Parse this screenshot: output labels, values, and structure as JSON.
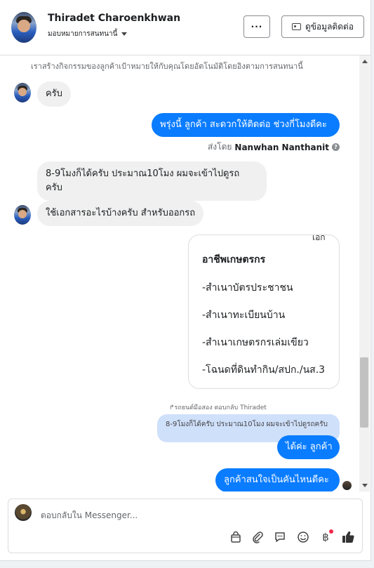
{
  "header": {
    "contact_name": "Thiradet Charoenkhwan",
    "assign_label": "มอบหมายการสนทนานี้",
    "more_label": "···",
    "contact_info_label": "ดูข้อมูลติดต่อ"
  },
  "conversation": {
    "system_note": "เราสร้างกิจกรรมของลูกค้าเป้าหมายให้กับคุณโดยอัตโนมัติโดยอิงตามการสนทนานี้",
    "messages": [
      {
        "text": "ครับ"
      },
      {
        "text": "พรุ่งนี้ ลูกค้า สะดวกให้ติดต่อ ช่วงกี่โมงดีคะ"
      },
      {
        "text": "8-9โมงก็ได้ครับ ประมาณ10โมง ผมจะเข้าไปดูรถ ครับ"
      },
      {
        "text": "ใช้เอกสารอะไรบ้างครับ สำหรับออกรถ"
      },
      {
        "text": "ได้ค่ะ ลูกค้า"
      },
      {
        "text": "ลูกค้าสนใจเป็นคันไหนดีคะ"
      }
    ],
    "sent_by_prefix": "ส่งโดย",
    "sent_by_name": "Nanwhan Nanthanit",
    "sent_by_help": "?",
    "image_card": {
      "cut_text": "เอก",
      "title": "อาชีพเกษตรกร",
      "lines": [
        "-สำเนาบัตรประชาชน",
        "-สำเนาทะเบียนบ้าน",
        "-สำเนาเกษตรกรเล่มเขียว",
        "-โฉนดที่ดินทำกิน/สปก./นส.3"
      ]
    },
    "reply_note": "รถยนต์มือสอง ตอบกลับ Thiradet",
    "reply_quote": "8-9โมงก็ได้ครับ ประมาณ10โมง ผมจะเข้าไปดูรถครับ"
  },
  "composer": {
    "placeholder": "ตอบกลับใน Messenger...",
    "tools": [
      "bag-icon",
      "paperclip-icon",
      "saved-reply-icon",
      "emoji-icon",
      "baht-icon",
      "like-icon"
    ],
    "baht_symbol": "฿"
  }
}
